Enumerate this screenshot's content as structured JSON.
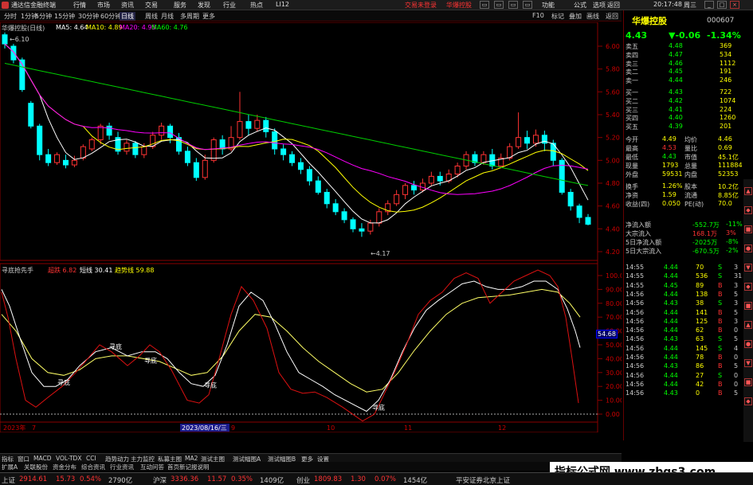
{
  "titlebar": {
    "app": "通达信金融终端",
    "menus": [
      "行情",
      "市场",
      "资讯",
      "交易",
      "服务",
      "发现",
      "行业",
      "热点",
      "LI12"
    ],
    "center_left": "交易未登录",
    "center_right": "华爆控股",
    "right": [
      "功能",
      "公式",
      "选项",
      "返回"
    ],
    "time": "20:17:48",
    "weekday": "周三"
  },
  "toolbar": {
    "periods": [
      "分时",
      "1分钟",
      "5分钟",
      "15分钟",
      "30分钟",
      "60分钟",
      "日线",
      "周线",
      "月线",
      "多周期",
      "更多"
    ],
    "active": "日线",
    "right": [
      "F10",
      "标记",
      "叠加",
      "画线",
      "返回"
    ]
  },
  "main_chart": {
    "stock": "华爆控股(日线)",
    "ma": [
      {
        "label": "MA5: 4.64",
        "color": "#ffffff"
      },
      {
        "label": "MA10: 4.89",
        "color": "#ffff00"
      },
      {
        "label": "MA20: 4.95",
        "color": "#ff00ff"
      },
      {
        "label": "MA60: 4.76",
        "color": "#00ff00"
      }
    ],
    "high_label": "6.10",
    "low_label": "4.17",
    "price_ticks": [
      "6.00",
      "5.80",
      "5.60",
      "5.40",
      "5.20",
      "5.00",
      "4.80",
      "4.60",
      "4.40",
      "4.20"
    ]
  },
  "indicator": {
    "name": "寻底抢先手",
    "fields": [
      {
        "label": "超跌",
        "value": "6.82",
        "color": "#ff3333"
      },
      {
        "label": "短线",
        "value": "30.41",
        "color": "#ffffff"
      },
      {
        "label": "趋势线",
        "value": "59.88",
        "color": "#ffff00"
      }
    ],
    "ticks": [
      "100.00",
      "90.00",
      "80.00",
      "70.00",
      "60.00",
      "50.00",
      "40.00",
      "30.00",
      "20.00",
      "10.00",
      "0.00"
    ],
    "current": "54.68",
    "signal_label": "寻底",
    "signals": [
      "寻底",
      "寻底",
      "寻底",
      "寻底",
      "寻底"
    ]
  },
  "xaxis": {
    "labels": [
      "2023年",
      "7",
      "2023/08/16/三",
      "9",
      "10",
      "11",
      "12"
    ]
  },
  "right_panel": {
    "name": "华爆控股",
    "code": "000607",
    "price": "4.43",
    "change": "▼-0.06",
    "pct": "-1.34%",
    "asks": [
      [
        "卖五",
        "4.48",
        "369"
      ],
      [
        "卖四",
        "4.47",
        "534"
      ],
      [
        "卖三",
        "4.46",
        "1112"
      ],
      [
        "卖二",
        "4.45",
        "191"
      ],
      [
        "卖一",
        "4.44",
        "246"
      ]
    ],
    "bids": [
      [
        "买一",
        "4.43",
        "722"
      ],
      [
        "买二",
        "4.42",
        "1074"
      ],
      [
        "买三",
        "4.41",
        "224"
      ],
      [
        "买四",
        "4.40",
        "1260"
      ],
      [
        "买五",
        "4.39",
        "201"
      ]
    ],
    "stats": [
      [
        "今开",
        "4.49",
        "均价",
        "4.46"
      ],
      [
        "最高",
        "4.53",
        "量比",
        "0.69"
      ],
      [
        "最低",
        "4.43",
        "市值",
        "45.1亿"
      ],
      [
        "现量",
        "1793",
        "总量",
        "111884"
      ],
      [
        "外盘",
        "59531",
        "内盘",
        "52353"
      ],
      [
        "换手",
        "1.26%",
        "股本",
        "10.2亿"
      ],
      [
        "净资",
        "1.59",
        "流通",
        "8.85亿"
      ],
      [
        "收益(四)",
        "0.050",
        "PE(动)",
        "70.0"
      ]
    ],
    "flow": [
      [
        "净流入额",
        "-552.7万",
        "-11%"
      ],
      [
        "大宗流入",
        "168.1万",
        "3%"
      ],
      [
        "5日净流入额",
        "-2025万",
        "-8%"
      ],
      [
        "5日大宗流入",
        "-670.5万",
        "-2%"
      ]
    ],
    "ticks": [
      [
        "14:55",
        "4.44",
        "70",
        "S",
        "3"
      ],
      [
        "14:55",
        "4.44",
        "536",
        "S",
        "31"
      ],
      [
        "14:55",
        "4.45",
        "89",
        "B",
        "3"
      ],
      [
        "14:56",
        "4.44",
        "138",
        "B",
        "5"
      ],
      [
        "14:56",
        "4.43",
        "38",
        "S",
        "3"
      ],
      [
        "14:56",
        "4.44",
        "141",
        "B",
        "5"
      ],
      [
        "14:56",
        "4.44",
        "125",
        "B",
        "3"
      ],
      [
        "14:56",
        "4.44",
        "62",
        "B",
        "0"
      ],
      [
        "14:56",
        "4.43",
        "63",
        "S",
        "5"
      ],
      [
        "14:56",
        "4.44",
        "145",
        "S",
        "4"
      ],
      [
        "14:56",
        "4.44",
        "78",
        "B",
        "0"
      ],
      [
        "14:56",
        "4.43",
        "86",
        "B",
        "5"
      ],
      [
        "14:56",
        "4.44",
        "27",
        "S",
        "0"
      ],
      [
        "14:56",
        "4.44",
        "42",
        "B",
        "0"
      ],
      [
        "14:56",
        "4.43",
        "0",
        "B",
        "5"
      ]
    ]
  },
  "bottom_tabs": [
    "指标",
    "窗口",
    "MACD",
    "VOL-TDX",
    "CCI",
    "趋势动力",
    "主力监控",
    "私募主图",
    "MA2",
    "测试主图",
    "测试幅图A",
    "测试幅图B",
    "更多",
    "设置"
  ],
  "bottom_tabs2": [
    "扩展A",
    "关联股份",
    "资金分布",
    "综合资讯",
    "行业资讯",
    "互动问答",
    "首页新记报说明"
  ],
  "statusbar": [
    {
      "label": "上证",
      "value": "2914.61",
      "chg": "15.73",
      "pct": "0.54%",
      "amt": "2790亿"
    },
    {
      "label": "沪深",
      "value": "3336.36",
      "chg": "11.57",
      "pct": "0.35%",
      "amt": "1409亿"
    },
    {
      "label": "创业",
      "value": "1809.83",
      "chg": "1.30",
      "pct": "0.07%",
      "amt": "1454亿"
    }
  ],
  "status_right": "平安证券北京上证",
  "watermark": "指标公式网 www.zbgs3.com",
  "colors": {
    "up": "#ff3333",
    "down": "#00ffff",
    "ma5": "#ffffff",
    "ma10": "#ffff00",
    "ma20": "#ff00ff",
    "ma60": "#00cc00"
  }
}
